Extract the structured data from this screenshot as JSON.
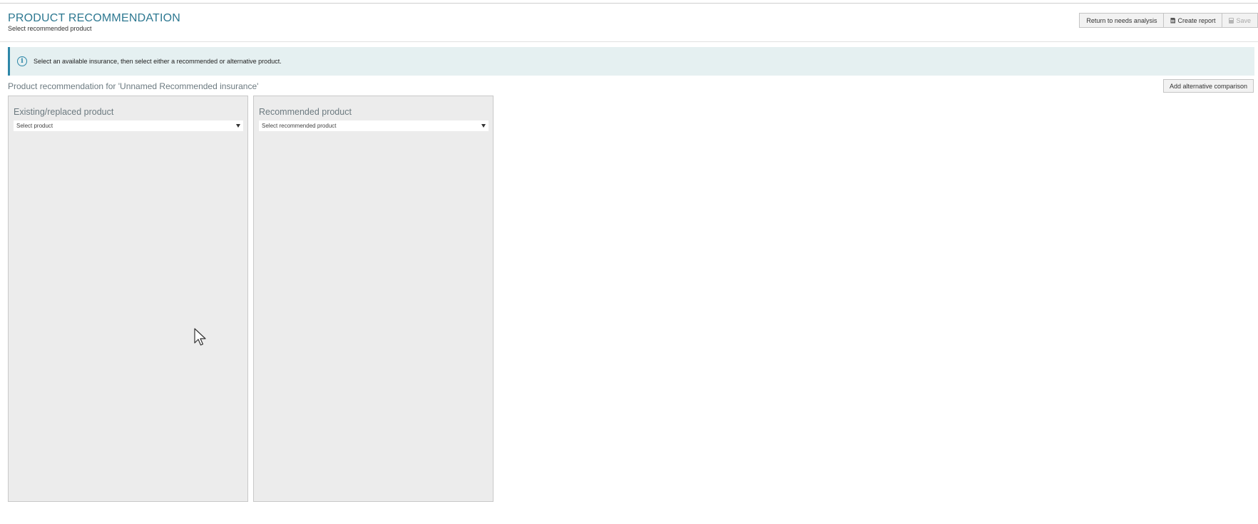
{
  "header": {
    "title": "PRODUCT RECOMMENDATION",
    "subtitle": "Select recommended product",
    "toolbar": {
      "return_label": "Return to needs analysis",
      "create_report_label": "Create report",
      "save_label": "Save"
    }
  },
  "info_banner": {
    "text": "Select an available insurance, then select either a recommended or alternative product."
  },
  "section": {
    "title": "Product recommendation for 'Unnamed Recommended insurance'",
    "add_alt_label": "Add alternative comparison"
  },
  "panels": [
    {
      "title": "Existing/replaced product",
      "select_value": "Select product"
    },
    {
      "title": "Recommended product",
      "select_value": "Select recommended product"
    }
  ],
  "colors": {
    "accent": "#2d7891",
    "banner_bg": "#e5f0f1",
    "banner_border": "#2d87a8",
    "panel_bg": "#ececec"
  }
}
